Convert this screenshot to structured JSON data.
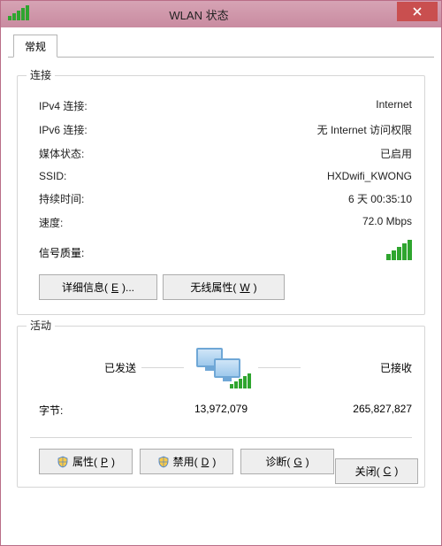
{
  "titlebar": {
    "title": "WLAN 状态",
    "close_tooltip": "关闭"
  },
  "tabs": {
    "general": "常规"
  },
  "connection": {
    "header": "连接",
    "ipv4_label": "IPv4 连接:",
    "ipv4_value": "Internet",
    "ipv6_label": "IPv6 连接:",
    "ipv6_value": "无 Internet 访问权限",
    "media_label": "媒体状态:",
    "media_value": "已启用",
    "ssid_label": "SSID:",
    "ssid_value": "HXDwifi_KWONG",
    "duration_label": "持续时间:",
    "duration_value": "6 天 00:35:10",
    "speed_label": "速度:",
    "speed_value": "72.0 Mbps",
    "signal_label": "信号质量:"
  },
  "buttons": {
    "details_pre": "详细信息(",
    "details_u": "E",
    "details_post": ")...",
    "wireless_pre": "无线属性(",
    "wireless_u": "W",
    "wireless_post": ")",
    "properties_pre": "属性(",
    "properties_u": "P",
    "properties_post": ")",
    "disable_pre": "禁用(",
    "disable_u": "D",
    "disable_post": ")",
    "diagnose_pre": "诊断(",
    "diagnose_u": "G",
    "diagnose_post": ")",
    "close_pre": "关闭(",
    "close_u": "C",
    "close_post": ")"
  },
  "activity": {
    "header": "活动",
    "sent_label": "已发送",
    "recv_label": "已接收",
    "bytes_label": "字节:",
    "sent_value": "13,972,079",
    "recv_value": "265,827,827"
  }
}
